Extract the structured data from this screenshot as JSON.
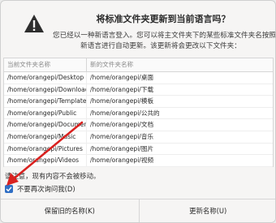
{
  "dialog": {
    "title": "将标准文件夹更新到当前语言吗？",
    "body_line1": "您已经以一种新语言登入。您可以将主文件夹下的某些标准文件夹名按照",
    "body_line2": "新语言进行自动更新。该更新将会更改以下文件夹："
  },
  "table": {
    "headers": [
      "当前文件夹名称",
      "新的文件夹名称"
    ],
    "rows": [
      [
        "/home/orangepi/Desktop",
        "/home/orangepi/桌面"
      ],
      [
        "/home/orangepi/Downloads",
        "/home/orangepi/下载"
      ],
      [
        "/home/orangepi/Templates",
        "/home/orangepi/模板"
      ],
      [
        "/home/orangepi/Public",
        "/home/orangepi/公共的"
      ],
      [
        "/home/orangepi/Documents",
        "/home/orangepi/文档"
      ],
      [
        "/home/orangepi/Music",
        "/home/orangepi/音乐"
      ],
      [
        "/home/orangepi/Pictures",
        "/home/orangepi/图片"
      ],
      [
        "/home/orangepi/Videos",
        "/home/orangepi/视频"
      ]
    ]
  },
  "note": "请注意，现有内容不会被移动。",
  "checkbox": {
    "label": "不要再次询问我(D)",
    "checked": true
  },
  "buttons": {
    "keep": "保留旧的名称(K)",
    "update": "更新名称(U)"
  },
  "colors": {
    "accent": "#2f6ec4",
    "annotation_arrow": "#d9211f"
  },
  "icons": {
    "dialog": "warning-icon",
    "checkbox": "checkmark-icon"
  }
}
